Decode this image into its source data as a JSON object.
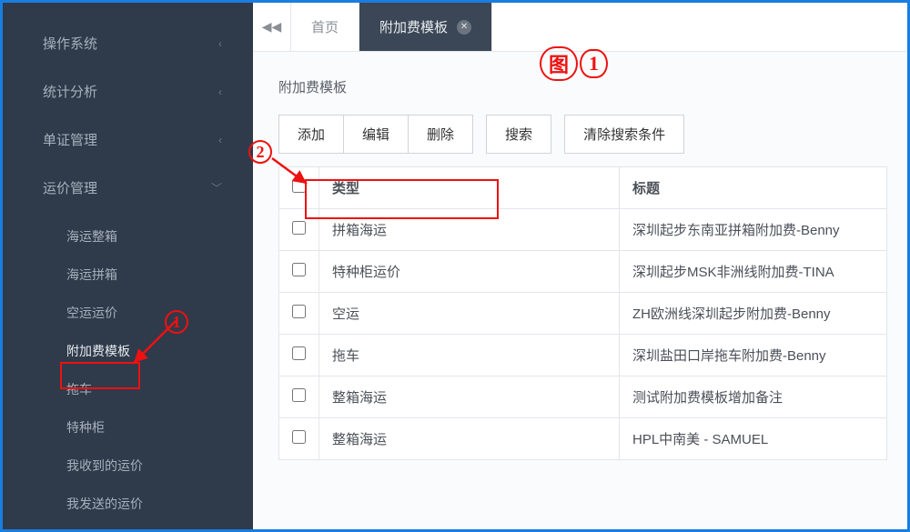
{
  "sidebar": {
    "groups": [
      {
        "label": "操作系统",
        "expanded": false
      },
      {
        "label": "统计分析",
        "expanded": false
      },
      {
        "label": "单证管理",
        "expanded": false
      },
      {
        "label": "运价管理",
        "expanded": true
      }
    ],
    "freight_items": [
      "海运整箱",
      "海运拼箱",
      "空运运价",
      "附加费模板",
      "拖车",
      "特种柜",
      "我收到的运价",
      "我发送的运价"
    ],
    "active_sub_index": 3
  },
  "tabs": {
    "home": "首页",
    "active": "附加费模板"
  },
  "page": {
    "title": "附加费模板"
  },
  "toolbar": {
    "add": "添加",
    "edit": "编辑",
    "delete": "删除",
    "search": "搜索",
    "clear": "清除搜索条件"
  },
  "table": {
    "headers": {
      "type": "类型",
      "title": "标题"
    },
    "rows": [
      {
        "type": "拼箱海运",
        "title": "深圳起步东南亚拼箱附加费-Benny"
      },
      {
        "type": "特种柜运价",
        "title": "深圳起步MSK非洲线附加费-TINA"
      },
      {
        "type": "空运",
        "title": "ZH欧洲线深圳起步附加费-Benny"
      },
      {
        "type": "拖车",
        "title": "深圳盐田口岸拖车附加费-Benny"
      },
      {
        "type": "整箱海运",
        "title": "测试附加费模板增加备注"
      },
      {
        "type": "整箱海运",
        "title": "HPL中南美 - SAMUEL"
      }
    ]
  },
  "annotations": {
    "n1": "1",
    "n2": "2",
    "fig": "图",
    "fig_n": "1"
  }
}
